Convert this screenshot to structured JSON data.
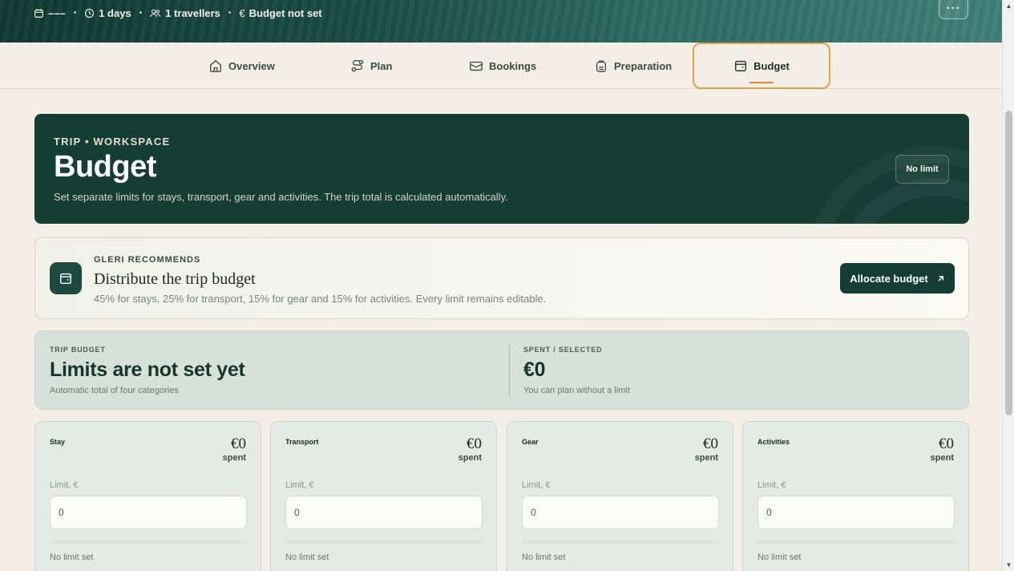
{
  "trip_meta": {
    "dates": "–––",
    "duration": "1 days",
    "travellers": "1 travellers",
    "budget_status": "Budget not set",
    "menu_label": "···"
  },
  "tabs": [
    {
      "label": "Overview",
      "icon": "home-icon"
    },
    {
      "label": "Plan",
      "icon": "route-icon"
    },
    {
      "label": "Bookings",
      "icon": "ticket-icon"
    },
    {
      "label": "Preparation",
      "icon": "backpack-icon"
    },
    {
      "label": "Budget",
      "icon": "wallet-icon",
      "active": true
    }
  ],
  "header": {
    "eyebrow": "TRIP • WORKSPACE",
    "title": "Budget",
    "subtitle": "Set separate limits for stays, transport, gear and activities. The trip total is calculated automatically.",
    "badge": "No limit"
  },
  "recommendation": {
    "eyebrow": "GLERI RECOMMENDS",
    "title": "Distribute the trip budget",
    "description": "45% for stays, 25% for transport, 15% for gear and 15% for activities. Every limit remains editable.",
    "button_label": "Allocate budget"
  },
  "summary": {
    "budget_label": "TRIP BUDGET",
    "budget_value": "Limits are not set yet",
    "budget_note": "Automatic total of four categories",
    "spent_label": "SPENT / SELECTED",
    "spent_value": "€0",
    "spent_note": "You can plan without a limit"
  },
  "categories": [
    {
      "name": "Stay",
      "amount": "€0",
      "spent_label": "spent",
      "limit_label": "Limit, €",
      "limit_value": "0",
      "status": "No limit set",
      "fill": 0
    },
    {
      "name": "Transport",
      "amount": "€0",
      "spent_label": "spent",
      "limit_label": "Limit, €",
      "limit_value": "0",
      "status": "No limit set",
      "fill": 0
    },
    {
      "name": "Gear",
      "amount": "€0",
      "spent_label": "spent",
      "limit_label": "Limit, €",
      "limit_value": "0",
      "status": "No limit set",
      "fill": 0
    },
    {
      "name": "Activities",
      "amount": "€0",
      "spent_label": "spent",
      "limit_label": "Limit, €",
      "limit_value": "0",
      "status": "No limit set",
      "fill": 0
    }
  ],
  "colors": {
    "primary": "#143d34",
    "accent": "#e0a243",
    "background": "#f3efe7"
  }
}
